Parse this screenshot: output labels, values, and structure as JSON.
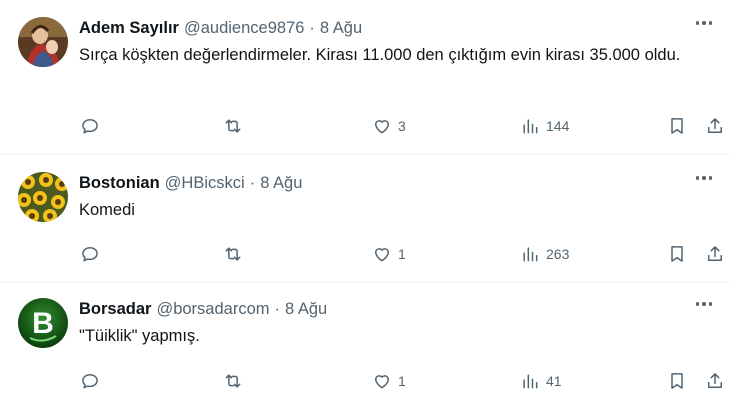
{
  "tweets": [
    {
      "author": "Adem Sayılır",
      "handle": "@audience9876",
      "separator": "·",
      "time": "8 Ağu",
      "text": "Sırça köşkten değerlendirmeler. Kirası 11.000 den çıktığım evin kirası 35.000 oldu.",
      "likes": "3",
      "views": "144"
    },
    {
      "author": "Bostonian",
      "handle": "@HBicskci",
      "separator": "·",
      "time": "8 Ağu",
      "text": "Komedi",
      "likes": "1",
      "views": "263"
    },
    {
      "author": "Borsadar",
      "handle": "@borsadarcom",
      "separator": "·",
      "time": "8 Ağu",
      "text": "\"Tüiklik\" yapmış.",
      "likes": "1",
      "views": "41"
    }
  ],
  "icons": {
    "reply": "reply-icon",
    "retweet": "retweet-icon",
    "like": "heart-icon",
    "views": "views-icon",
    "bookmark": "bookmark-icon",
    "share": "share-icon",
    "more": "more-icon"
  },
  "avatar_letter": "B"
}
